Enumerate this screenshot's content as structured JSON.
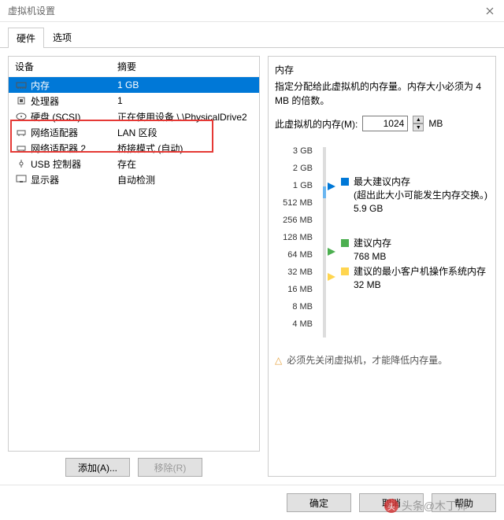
{
  "window": {
    "title": "虚拟机设置"
  },
  "tabs": {
    "hardware": "硬件",
    "options": "选项"
  },
  "device_list": {
    "header_device": "设备",
    "header_summary": "摘要",
    "rows": [
      {
        "name": "内存",
        "summary": "1 GB",
        "icon": "memory"
      },
      {
        "name": "处理器",
        "summary": "1",
        "icon": "cpu"
      },
      {
        "name": "硬盘 (SCSI)",
        "summary": "正在使用设备 \\.\\PhysicalDrive2",
        "icon": "disk"
      },
      {
        "name": "网络适配器",
        "summary": "LAN 区段",
        "icon": "net"
      },
      {
        "name": "网络适配器 2",
        "summary": "桥接模式 (自动)",
        "icon": "net"
      },
      {
        "name": "USB 控制器",
        "summary": "存在",
        "icon": "usb"
      },
      {
        "name": "显示器",
        "summary": "自动检测",
        "icon": "display"
      }
    ],
    "add_btn": "添加(A)...",
    "remove_btn": "移除(R)"
  },
  "memory_panel": {
    "title": "内存",
    "desc": "指定分配给此虚拟机的内存量。内存大小必须为 4 MB 的倍数。",
    "field_label": "此虚拟机的内存(M):",
    "field_value": "1024",
    "field_unit": "MB",
    "ticks": [
      "3 GB",
      "2 GB",
      "1 GB",
      "512 MB",
      "256 MB",
      "128 MB",
      "64 MB",
      "32 MB",
      "16 MB",
      "8 MB",
      "4 MB"
    ],
    "legend_max": "最大建议内存",
    "legend_max_note": "(超出此大小可能发生内存交换。)",
    "legend_max_val": "5.9 GB",
    "legend_rec": "建议内存",
    "legend_rec_val": "768 MB",
    "legend_min": "建议的最小客户机操作系统内存",
    "legend_min_val": "32 MB",
    "warn": "必须先关闭虚拟机，才能降低内存量。"
  },
  "footer": {
    "ok": "确定",
    "cancel": "取消",
    "help": "帮助"
  },
  "watermark": "头条@木丁师"
}
